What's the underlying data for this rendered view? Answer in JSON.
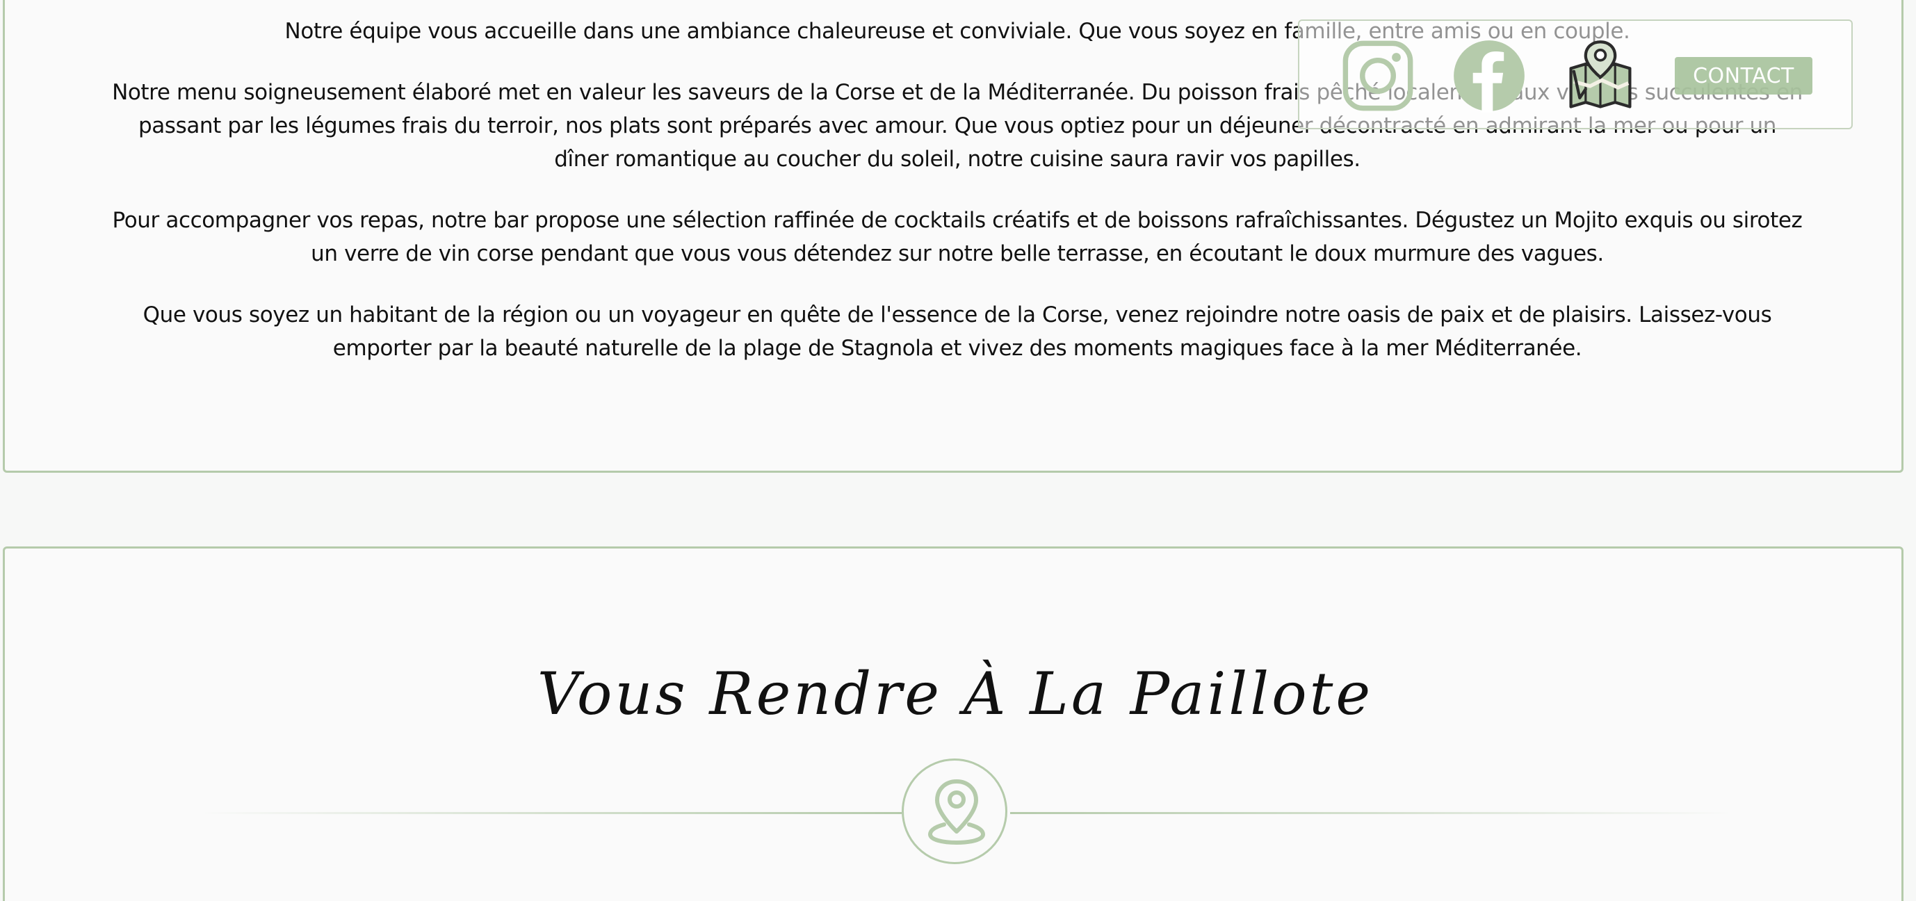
{
  "about": {
    "paragraphs": [
      "Notre équipe vous accueille dans une ambiance chaleureuse et conviviale. Que vous soyez en famille, entre amis ou en couple.",
      "Notre menu soigneusement élaboré met en valeur les saveurs de la Corse et de la Méditerranée. Du poisson frais pêché localement aux viandes succulentes en passant par les légumes frais du terroir, nos plats sont préparés avec amour. Que vous optiez pour un déjeuner décontracté en admirant la mer ou pour un dîner romantique au coucher du soleil, notre cuisine saura ravir vos papilles.",
      "Pour accompagner vos repas, notre bar propose une sélection raffinée de cocktails créatifs et de boissons rafraîchissantes. Dégustez un Mojito exquis ou sirotez un verre de vin corse pendant que vous vous détendez sur notre belle terrasse, en écoutant le doux murmure des vagues.",
      "Que vous soyez un habitant de la région ou un voyageur en quête de l'essence de la Corse, venez rejoindre notre oasis de paix et de plaisirs. Laissez-vous emporter par la beauté naturelle de la plage de Stagnola et vivez des moments magiques face à la mer Méditerranée."
    ]
  },
  "social_bar": {
    "icons": [
      "instagram-icon",
      "facebook-icon",
      "map-icon"
    ],
    "contact_label": "CONTACT"
  },
  "directions": {
    "title": "Vous Rendre À La Paillote",
    "icon": "location-pin-icon"
  },
  "colors": {
    "accent": "#b5cbab",
    "button": "#a7c39c",
    "text": "#111111",
    "background": "#fafafa"
  }
}
